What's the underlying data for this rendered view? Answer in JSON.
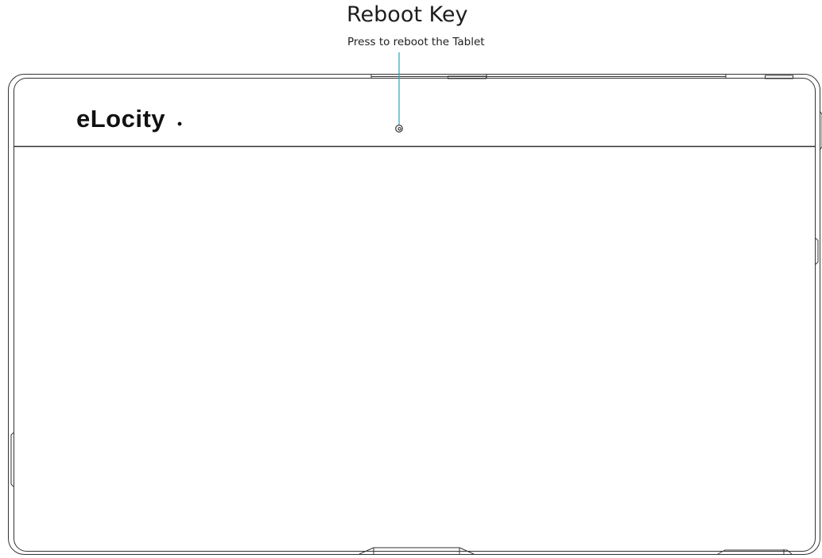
{
  "callout": {
    "title": "Reboot Key",
    "description": "Press to reboot the Tablet",
    "line_color": "#2a9fc4"
  },
  "device": {
    "brand_logo": "eLocity",
    "outline_color": "#333333"
  }
}
